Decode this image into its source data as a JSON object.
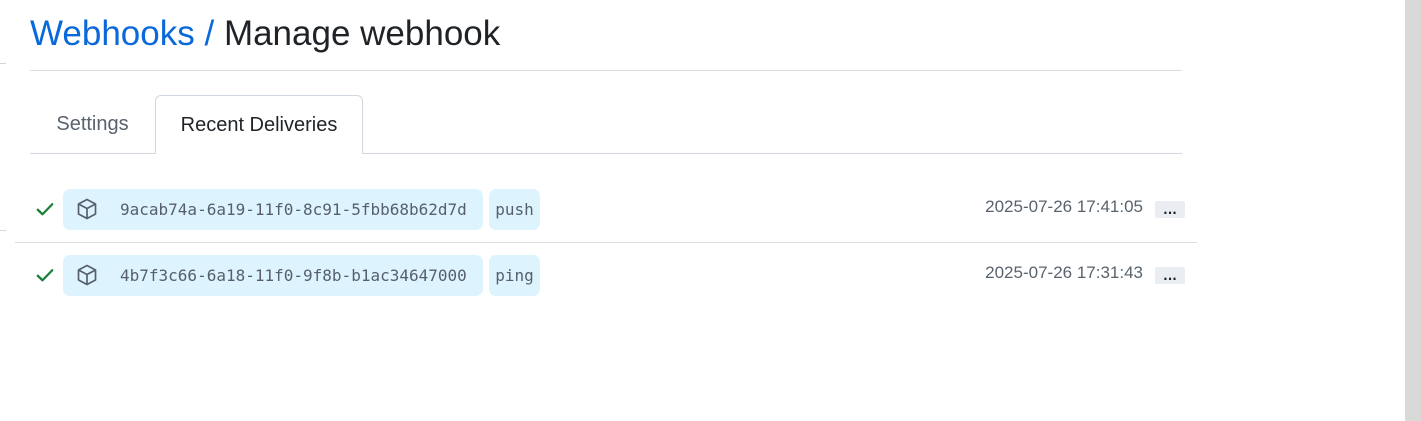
{
  "header": {
    "breadcrumb_link": "Webhooks",
    "separator": "/",
    "current": "Manage webhook"
  },
  "tabs": [
    {
      "label": "Settings",
      "selected": false
    },
    {
      "label": "Recent Deliveries",
      "selected": true
    }
  ],
  "deliveries": [
    {
      "status_icon": "check-icon",
      "type_icon": "package-icon",
      "guid": "9acab74a-6a19-11f0-8c91-5fbb68b62d7d",
      "event": "push",
      "timestamp": "2025-07-26 17:41:05",
      "more_label": "..."
    },
    {
      "status_icon": "check-icon",
      "type_icon": "package-icon",
      "guid": "4b7f3c66-6a18-11f0-9f8b-b1ac34647000",
      "event": "ping",
      "timestamp": "2025-07-26 17:31:43",
      "more_label": "..."
    }
  ],
  "colors": {
    "link": "#0969da",
    "success": "#1a7f37",
    "pill_background": "#ddf4ff",
    "border": "#d0d7de"
  }
}
